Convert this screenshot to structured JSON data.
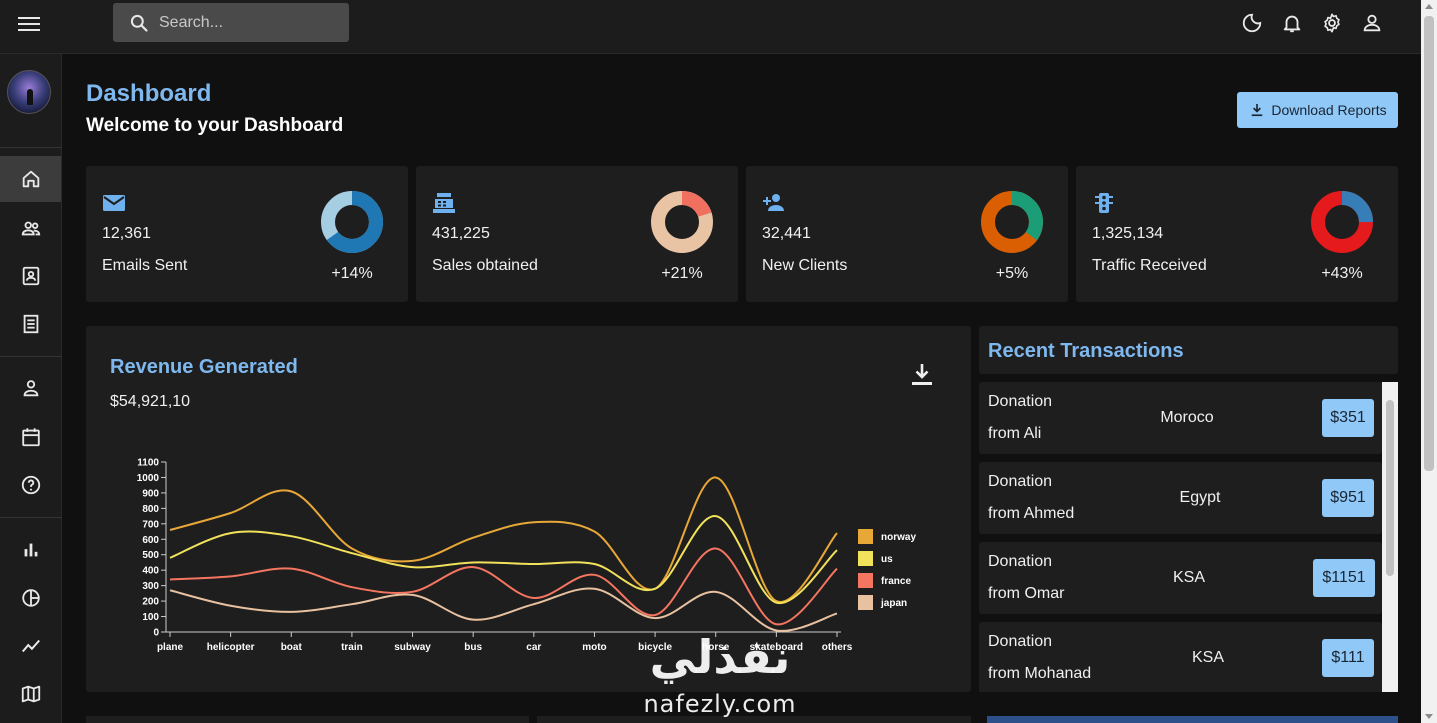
{
  "topbar": {
    "search_placeholder": "Search..."
  },
  "header": {
    "title": "Dashboard",
    "subtitle": "Welcome to your Dashboard",
    "download_label": "Download Reports"
  },
  "stats": [
    {
      "icon": "email-icon",
      "value": "12,361",
      "label": "Emails Sent",
      "change": "+14%",
      "fraction": 0.65,
      "colors": [
        "#1f77b4",
        "#a6cee3"
      ]
    },
    {
      "icon": "point-of-sale-icon",
      "value": "431,225",
      "label": "Sales obtained",
      "change": "+21%",
      "fraction": 0.2,
      "colors": [
        "#f07060",
        "#e8c4a4"
      ]
    },
    {
      "icon": "person-add-icon",
      "value": "32,441",
      "label": "New Clients",
      "change": "+5%",
      "fraction": 0.35,
      "colors": [
        "#1b9e77",
        "#d95f02"
      ]
    },
    {
      "icon": "traffic-icon",
      "value": "1,325,134",
      "label": "Traffic Received",
      "change": "+43%",
      "fraction": 0.25,
      "colors": [
        "#377eb8",
        "#e41a1c"
      ]
    }
  ],
  "revenue": {
    "title": "Revenue Generated",
    "value": "$54,921,10"
  },
  "chart_data": {
    "type": "line",
    "categories": [
      "plane",
      "helicopter",
      "boat",
      "train",
      "subway",
      "bus",
      "car",
      "moto",
      "bicycle",
      "horse",
      "skateboard",
      "others"
    ],
    "ylim": [
      0,
      1100
    ],
    "yticks": [
      0,
      100,
      200,
      300,
      400,
      500,
      600,
      700,
      800,
      900,
      1000,
      1100
    ],
    "grid": false,
    "legend": "right",
    "series": [
      {
        "name": "norway",
        "color": "#e8a838",
        "values": [
          660,
          770,
          910,
          540,
          460,
          610,
          710,
          650,
          280,
          1000,
          200,
          640
        ]
      },
      {
        "name": "us",
        "color": "#f1e15b",
        "values": [
          480,
          640,
          620,
          510,
          420,
          450,
          440,
          440,
          280,
          750,
          190,
          530
        ]
      },
      {
        "name": "france",
        "color": "#f47560",
        "values": [
          340,
          360,
          410,
          290,
          260,
          420,
          220,
          370,
          110,
          540,
          50,
          410
        ]
      },
      {
        "name": "japan",
        "color": "#e8c1a0",
        "values": [
          270,
          170,
          130,
          180,
          240,
          80,
          180,
          280,
          90,
          260,
          10,
          120
        ]
      }
    ]
  },
  "transactions": {
    "title": "Recent Transactions",
    "items": [
      {
        "line1": "Donation",
        "line2": "from Ali",
        "country": "Moroco",
        "amount": "$351"
      },
      {
        "line1": "Donation",
        "line2": "from Ahmed",
        "country": "Egypt",
        "amount": "$951"
      },
      {
        "line1": "Donation",
        "line2": "from Omar",
        "country": "KSA",
        "amount": "$1151"
      },
      {
        "line1": "Donation",
        "line2": "from Mohanad",
        "country": "KSA",
        "amount": "$111"
      }
    ]
  },
  "watermark": {
    "arabic": "نفذلي",
    "latin": "nafezly.com"
  }
}
